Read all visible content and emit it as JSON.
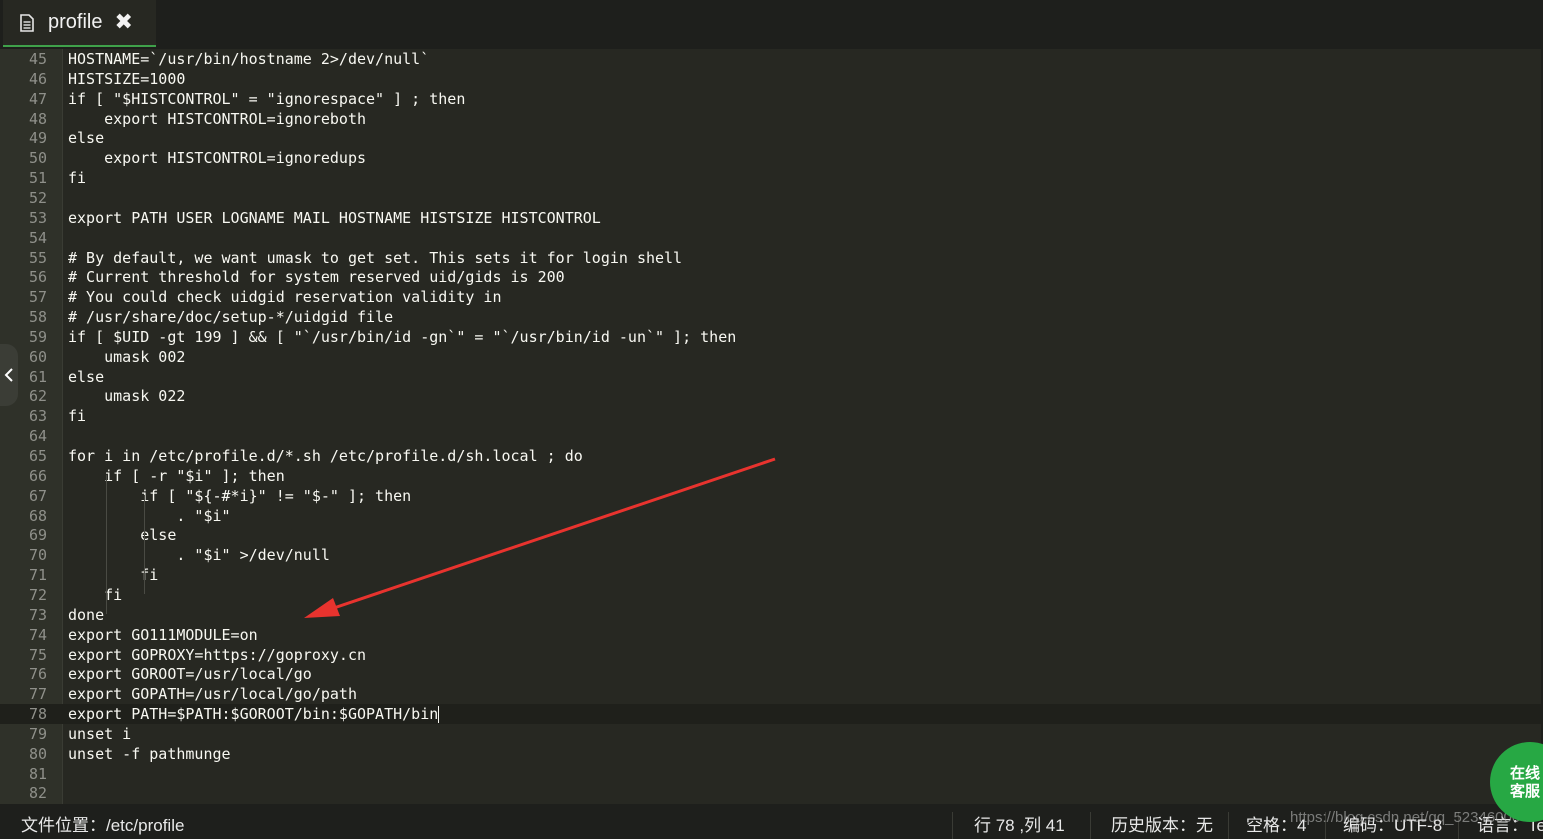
{
  "tab": {
    "label": "profile",
    "close_icon": "close-icon",
    "file_icon": "file-icon"
  },
  "editor": {
    "active_line": 78,
    "lines": [
      {
        "n": "45",
        "text": "HOSTNAME=`/usr/bin/hostname 2>/dev/null`"
      },
      {
        "n": "46",
        "text": "HISTSIZE=1000"
      },
      {
        "n": "47",
        "text": "if [ \"$HISTCONTROL\" = \"ignorespace\" ] ; then"
      },
      {
        "n": "48",
        "text": "    export HISTCONTROL=ignoreboth"
      },
      {
        "n": "49",
        "text": "else"
      },
      {
        "n": "50",
        "text": "    export HISTCONTROL=ignoredups"
      },
      {
        "n": "51",
        "text": "fi"
      },
      {
        "n": "52",
        "text": ""
      },
      {
        "n": "53",
        "text": "export PATH USER LOGNAME MAIL HOSTNAME HISTSIZE HISTCONTROL"
      },
      {
        "n": "54",
        "text": ""
      },
      {
        "n": "55",
        "text": "# By default, we want umask to get set. This sets it for login shell"
      },
      {
        "n": "56",
        "text": "# Current threshold for system reserved uid/gids is 200"
      },
      {
        "n": "57",
        "text": "# You could check uidgid reservation validity in"
      },
      {
        "n": "58",
        "text": "# /usr/share/doc/setup-*/uidgid file"
      },
      {
        "n": "59",
        "text": "if [ $UID -gt 199 ] && [ \"`/usr/bin/id -gn`\" = \"`/usr/bin/id -un`\" ]; then"
      },
      {
        "n": "60",
        "text": "    umask 002"
      },
      {
        "n": "61",
        "text": "else"
      },
      {
        "n": "62",
        "text": "    umask 022"
      },
      {
        "n": "63",
        "text": "fi"
      },
      {
        "n": "64",
        "text": ""
      },
      {
        "n": "65",
        "text": "for i in /etc/profile.d/*.sh /etc/profile.d/sh.local ; do"
      },
      {
        "n": "66",
        "text": "    if [ -r \"$i\" ]; then"
      },
      {
        "n": "67",
        "text": "        if [ \"${-#*i}\" != \"$-\" ]; then"
      },
      {
        "n": "68",
        "text": "            . \"$i\""
      },
      {
        "n": "69",
        "text": "        else"
      },
      {
        "n": "70",
        "text": "            . \"$i\" >/dev/null"
      },
      {
        "n": "71",
        "text": "        fi"
      },
      {
        "n": "72",
        "text": "    fi"
      },
      {
        "n": "73",
        "text": "done"
      },
      {
        "n": "74",
        "text": "export GO111MODULE=on"
      },
      {
        "n": "75",
        "text": "export GOPROXY=https://goproxy.cn"
      },
      {
        "n": "76",
        "text": "export GOROOT=/usr/local/go"
      },
      {
        "n": "77",
        "text": "export GOPATH=/usr/local/go/path"
      },
      {
        "n": "78",
        "text": "export PATH=$PATH:$GOROOT/bin:$GOPATH/bin"
      },
      {
        "n": "79",
        "text": "unset i"
      },
      {
        "n": "80",
        "text": "unset -f pathmunge"
      },
      {
        "n": "81",
        "text": ""
      },
      {
        "n": "82",
        "text": ""
      }
    ]
  },
  "statusbar": {
    "file_location": "文件位置：/etc/profile",
    "cursor_position": "行 78 ,列 41",
    "history_version": "历史版本：无",
    "spaces": "空格：4",
    "encoding": "编码：UTF-8",
    "language": "语言：Te"
  },
  "support_button": {
    "label": "在线客服"
  },
  "watermark": "https://blog.csdn.net/qq_52346000",
  "colors": {
    "editor_bg": "#272822",
    "text": "#f8f8f2",
    "line_number": "#8f908a",
    "tab_accent": "#3fa14a",
    "annotation_arrow": "#e8332e",
    "support_button": "#27a844"
  }
}
